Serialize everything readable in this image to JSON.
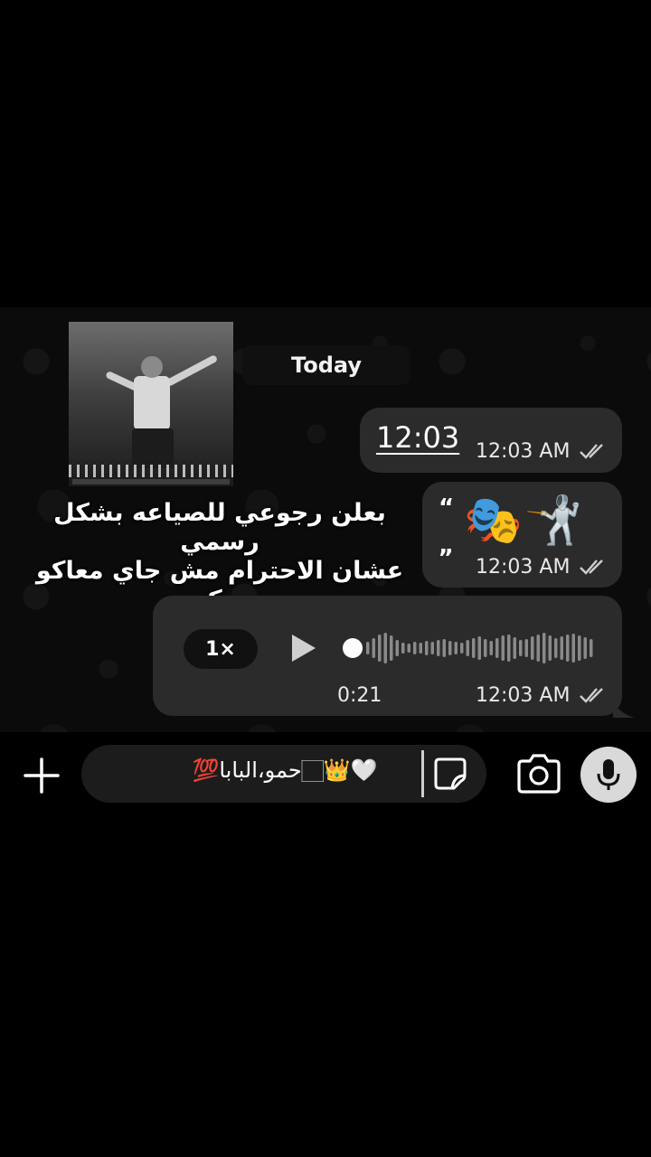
{
  "chat": {
    "date_label": "Today",
    "messages": [
      {
        "text": "12:03",
        "time": "12:03 AM"
      },
      {
        "quote_open": "“",
        "quote_close": "„",
        "emoji": "🎭🤺",
        "time": "12:03 AM"
      },
      {
        "type": "voice",
        "speed": "1×",
        "duration": "0:21",
        "time": "12:03 AM"
      }
    ],
    "overlay_text_line1": "بعلن رجوعي للصياعه بشكل رسمي",
    "overlay_text_line2": "عشان الاحترام مش جاي معاكو سكه"
  },
  "composer": {
    "value": "🤍👑🏻ﺣﻤﻮ،البابا💯",
    "icons": [
      "plus-icon",
      "sticker-icon",
      "camera-icon",
      "mic-icon"
    ]
  },
  "colors": {
    "background": "#000000",
    "bubble": "#2b2b2b",
    "text": "#ffffff",
    "mic_button": "#d9d9d9"
  }
}
